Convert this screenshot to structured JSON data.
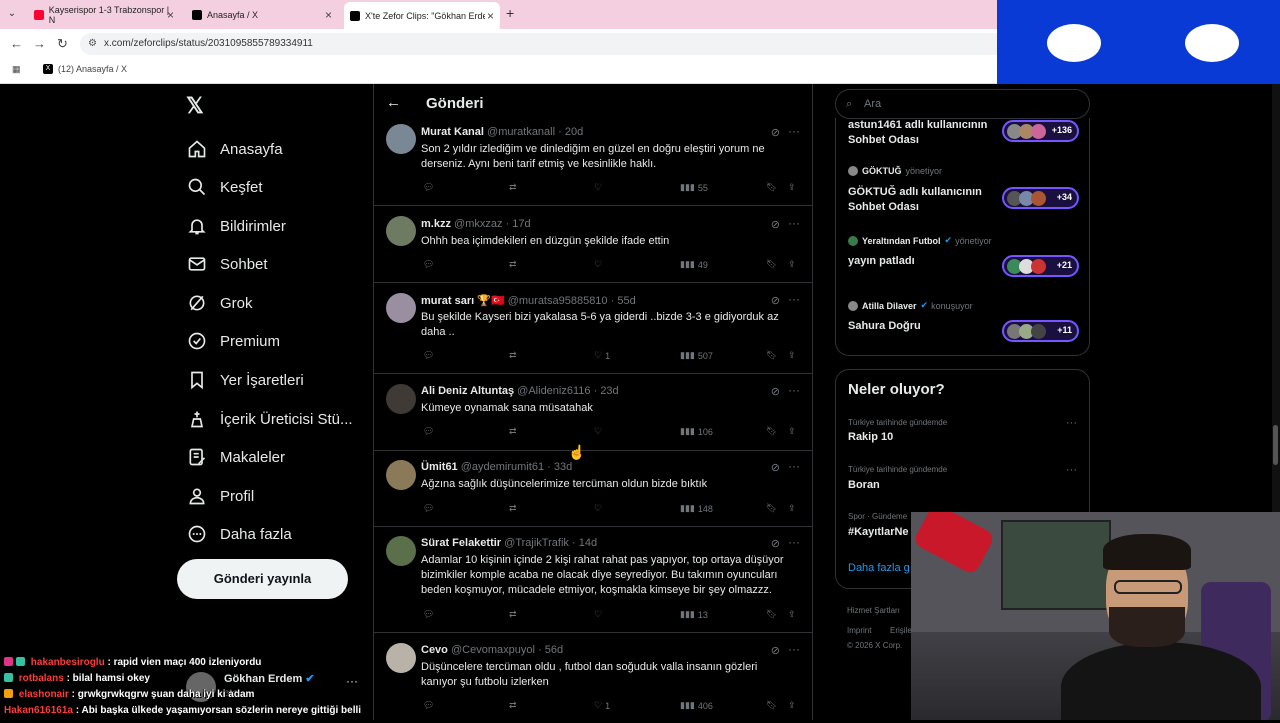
{
  "browser": {
    "tabs": [
      {
        "title": "Kayserispor 1-3 Trabzonspor | N",
        "color": "#ff0033"
      },
      {
        "title": "Anasayfa / X",
        "color": "#000000"
      },
      {
        "title": "X'te Zefor Clips: \"Gökhan Erdem",
        "color": "#000000"
      }
    ],
    "url": "x.com/zeforclips/status/2031095855789334911",
    "bookmark": "(12) Anasayfa / X"
  },
  "nav": {
    "items": [
      "Anasayfa",
      "Keşfet",
      "Bildirimler",
      "Sohbet",
      "Grok",
      "Premium",
      "Yer İşaretleri",
      "İçerik Üreticisi Stü...",
      "Makaleler",
      "Profil",
      "Daha fazla"
    ],
    "post_button": "Gönderi yayınla"
  },
  "header": {
    "title": "Gönderi"
  },
  "tweets": [
    {
      "name": "Murat Kanal",
      "handle": "@muratkanall",
      "age": "20d",
      "lines": [
        "Son 2 yıldır izlediğim ve dinlediğim en güzel en doğru eleştiri yorum ne",
        "derseniz. Aynı beni tarif etmiş ve kesinlikle haklı."
      ],
      "likes": "",
      "views": "55",
      "avatar": "#7a8896"
    },
    {
      "name": "m.kzz",
      "handle": "@mkxzaz",
      "age": "17d",
      "lines": [
        "Ohhh bea içimdekileri en düzgün şekilde ifade ettin"
      ],
      "likes": "",
      "views": "49",
      "avatar": "#6e7a62"
    },
    {
      "name": "murat sarı 🏆🇹🇷",
      "handle": "@muratsa95885810",
      "age": "55d",
      "lines": [
        "Bu şekilde Kayseri bizi yakalasa 5-6 ya giderdi ..bizde 3-3 e gidiyorduk az",
        "daha .."
      ],
      "likes": "1",
      "views": "507",
      "avatar": "#9a8fa0"
    },
    {
      "name": "Ali Deniz Altuntaş",
      "handle": "@Alideniz6116",
      "age": "23d",
      "lines": [
        "Kümeye oynamak sana müsatahak"
      ],
      "likes": "",
      "views": "106",
      "avatar": "#3f3a36"
    },
    {
      "name": "Ümit61",
      "handle": "@aydemirumit61",
      "age": "33d",
      "lines": [
        "Ağzına sağlık düşüncelerimize tercüman oldun bizde bıktık"
      ],
      "likes": "",
      "views": "148",
      "avatar": "#8a7a5a"
    },
    {
      "name": "Sürat Felakettir",
      "handle": "@TrajikTrafik",
      "age": "14d",
      "lines": [
        "Adamlar 10 kişinin içinde 2 kişi rahat rahat pas yapıyor, top ortaya düşüyor",
        "bizimkiler komple acaba ne olacak diye seyrediyor. Bu takımın oyuncuları",
        "beden koşmuyor, mücadele etmiyor, koşmakla kimseye bir şey olmazzz."
      ],
      "likes": "",
      "views": "13",
      "avatar": "#5b6f4a"
    },
    {
      "name": "Cevo",
      "handle": "@Cevomaxpuyol",
      "age": "56d",
      "lines": [
        "Düşüncelere tercüman oldu , futbol dan soğuduk valla insanın gözleri",
        "kanıyor şu futbolu izlerken"
      ],
      "likes": "1",
      "views": "406",
      "avatar": "#b8b2a8"
    }
  ],
  "search": {
    "placeholder": "Ara"
  },
  "spaces": [
    {
      "host": "",
      "role": "",
      "title": "astun1461 adlı kullanıcının Sohbet Odası",
      "count": "+136"
    },
    {
      "host": "GÖKTUĞ",
      "role": "yönetiyor",
      "title": "GÖKTUĞ adlı kullanıcının Sohbet Odası",
      "count": "+34"
    },
    {
      "host": "Yeraltından Futbol",
      "role": "yönetiyor",
      "title": "yayın patladı",
      "count": "+21"
    },
    {
      "host": "Atilla Dilaver",
      "role": "konuşuyor",
      "title": "Sahura Doğru",
      "count": "+11"
    }
  ],
  "trends": {
    "title": "Neler oluyor?",
    "items": [
      {
        "meta": "Türkiye tarihinde gündemde",
        "name": "Rakip 10"
      },
      {
        "meta": "Türkiye tarihinde gündemde",
        "name": "Boran"
      },
      {
        "meta": "Spor · Gündeme",
        "name": "#KayıtlarNe"
      }
    ],
    "show_more": "Daha fazla g"
  },
  "footer": [
    "Hizmet Şartları",
    "Imprint",
    "Erişile",
    "© 2026 X Corp."
  ],
  "account": {
    "name": "Gökhan Erdem",
    "handle": "ata"
  },
  "chat": [
    {
      "user": "hakanbesiroglu",
      "msg": ": rapid vien maçı 400 izleniyordu"
    },
    {
      "user": "rotbalans",
      "msg": ": bilal hamsi okey"
    },
    {
      "user": "elashonair",
      "msg": ": grwkgrwkqgrw şuan daha iyi ki adam"
    },
    {
      "user": "Hakan616161a",
      "msg": ": Abi başka ülkede yaşamıyorsan sözlerin nereye gittiği belli"
    }
  ],
  "colors": {
    "accent": "#1d9bf0",
    "space_border": "#7856ff",
    "stream_panel": "#0a3ad6"
  }
}
